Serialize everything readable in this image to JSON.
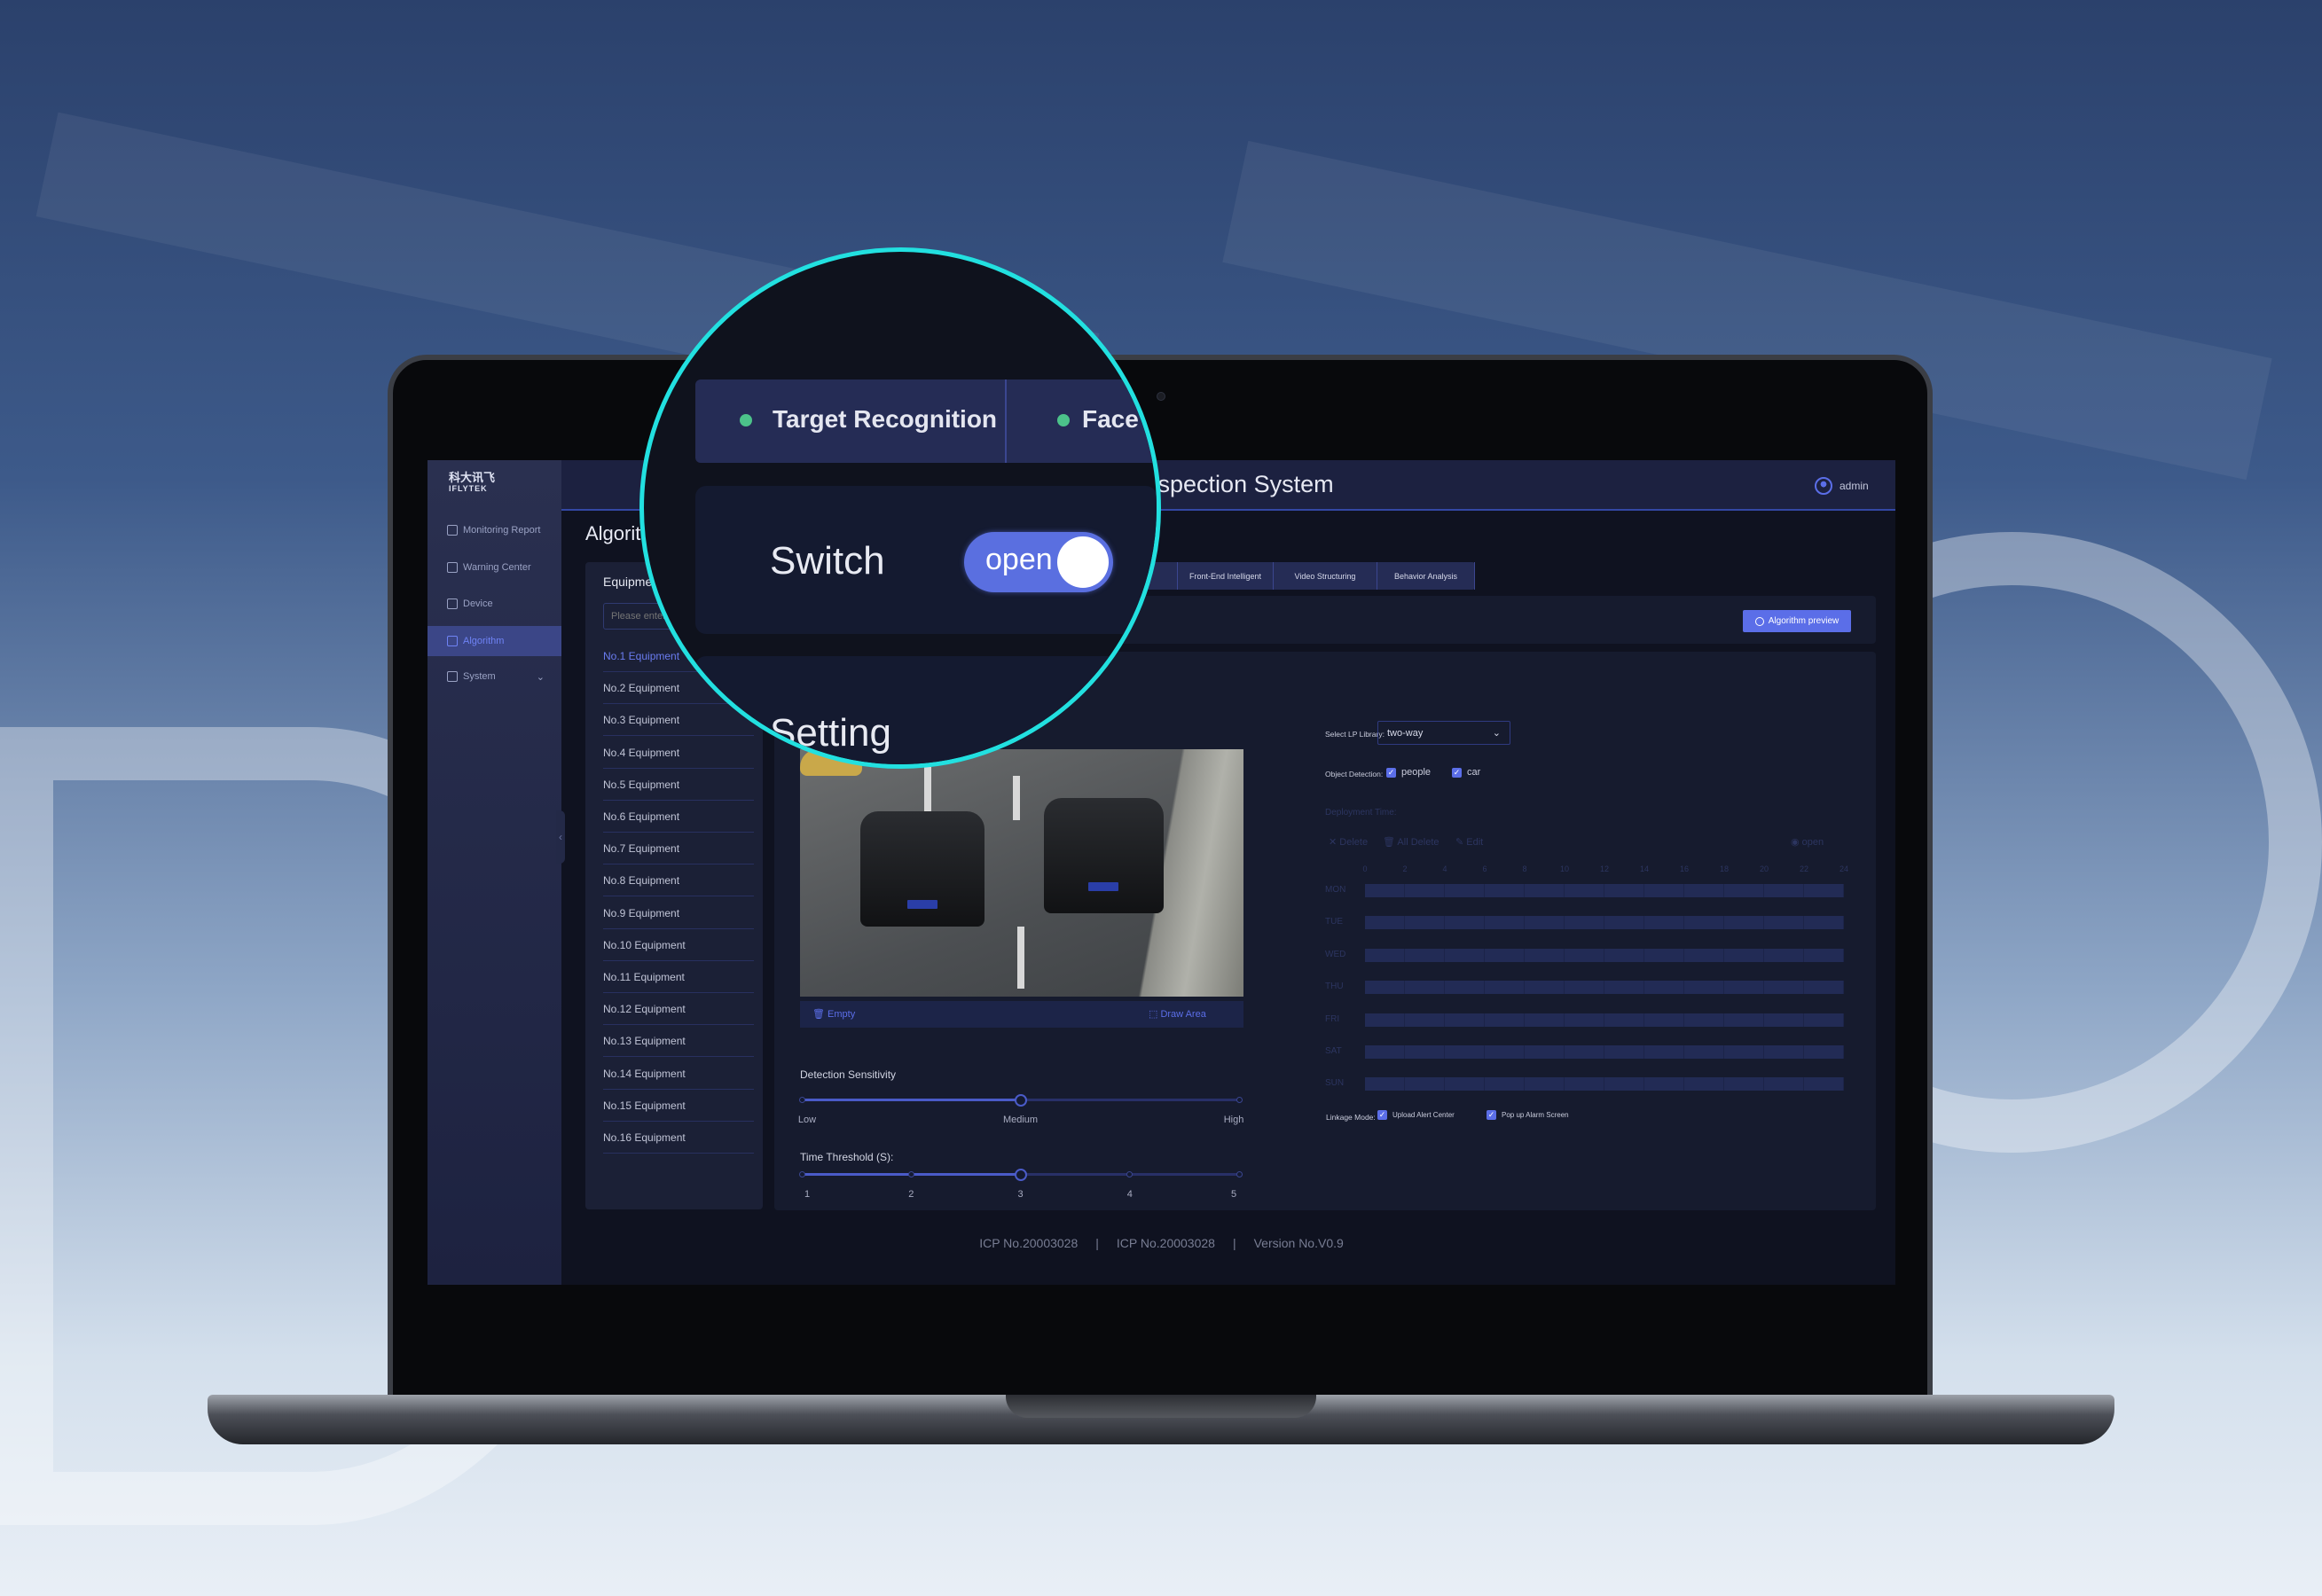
{
  "logo": {
    "cn": "科大讯飞",
    "en": "IFLYTEK"
  },
  "header": {
    "title": "Inspection System",
    "user": "admin"
  },
  "sidebar": {
    "items": [
      {
        "label": "Monitoring Report",
        "icon": "chart-icon"
      },
      {
        "label": "Warning Center",
        "icon": "bell-icon"
      },
      {
        "label": "Device",
        "icon": "device-icon"
      },
      {
        "label": "Algorithm",
        "icon": "algorithm-icon",
        "active": true
      },
      {
        "label": "System",
        "icon": "system-icon",
        "expandable": true
      }
    ]
  },
  "page": {
    "title": "Algorithm"
  },
  "equipment": {
    "title": "Equipment",
    "search_placeholder": "Please enter",
    "items": [
      "No.1 Equipment",
      "No.2 Equipment",
      "No.3 Equipment",
      "No.4 Equipment",
      "No.5 Equipment",
      "No.6 Equipment",
      "No.7 Equipment",
      "No.8 Equipment",
      "No.9 Equipment",
      "No.10 Equipment",
      "No.11 Equipment",
      "No.12 Equipment",
      "No.13 Equipment",
      "No.14 Equipment",
      "No.15 Equipment",
      "No.16 Equipment"
    ],
    "selected": 0
  },
  "tabs": [
    "Target Recognition",
    "Face Recognition",
    "Front-End Intelligent",
    "Video Structuring",
    "Behavior Analysis"
  ],
  "switch": {
    "label": "Switch",
    "state": "open",
    "on": true
  },
  "algorithm_preview": "Algorithm preview",
  "setting": {
    "title": "Setting",
    "empty": "Empty",
    "draw_area": "Draw Area",
    "sensitivity": {
      "label": "Detection Sensitivity",
      "options": [
        "Low",
        "Medium",
        "High"
      ],
      "value": "Medium"
    },
    "threshold": {
      "label": "Time Threshold (S):",
      "options": [
        "1",
        "2",
        "3",
        "4",
        "5"
      ],
      "value": 3
    },
    "lp_library": {
      "label": "Select LP Library:",
      "value": "two-way"
    },
    "object_detection": {
      "label": "Object Detection:",
      "options": [
        {
          "label": "people",
          "checked": true
        },
        {
          "label": "car",
          "checked": true
        }
      ]
    },
    "deployment": {
      "label": "Deployment Time:",
      "delete": "Delete",
      "all_delete": "All Delete",
      "edit": "Edit",
      "open": "open",
      "hours": [
        "0",
        "2",
        "4",
        "6",
        "8",
        "10",
        "12",
        "14",
        "16",
        "18",
        "20",
        "22",
        "24"
      ],
      "days": [
        "MON",
        "TUE",
        "WED",
        "THU",
        "FRI",
        "SAT",
        "SUN"
      ]
    },
    "linkage": {
      "label": "Linkage Mode:",
      "options": [
        {
          "label": "Upload Alert Center",
          "checked": true
        },
        {
          "label": "Pop up Alarm Screen",
          "checked": true
        }
      ]
    }
  },
  "footer": [
    "ICP No.20003028",
    "|",
    "ICP No.20003028",
    "|",
    "Version No.V0.9"
  ],
  "colors": {
    "accent": "#5b6ee8",
    "status_dot": "#4cc38a",
    "magnifier_ring": "#22e0e0"
  }
}
